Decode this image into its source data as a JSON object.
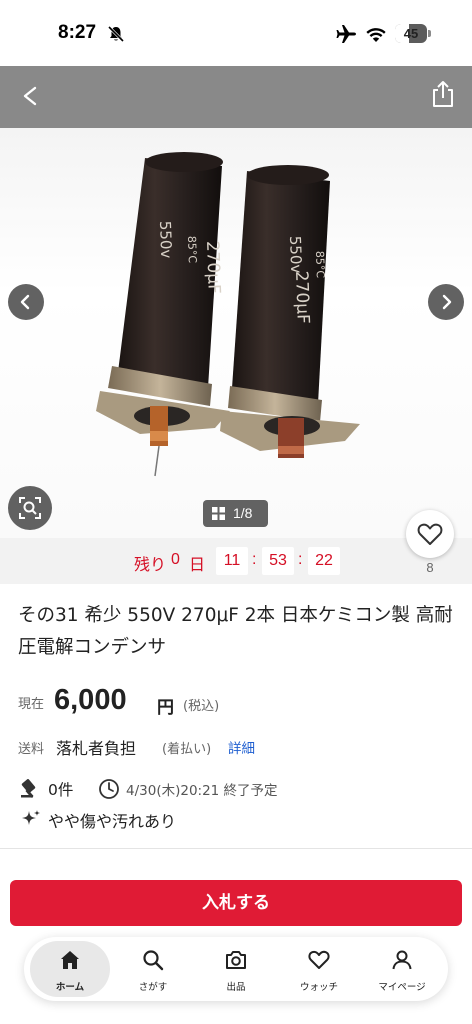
{
  "status_bar": {
    "time": "8:27",
    "battery": "45",
    "battery_fraction": 0.45
  },
  "photo": {
    "counter": "1/8",
    "icons": [
      "back-icon",
      "share-icon",
      "prev-image-icon",
      "next-image-icon",
      "image-search-icon",
      "grid-icon"
    ]
  },
  "timer": {
    "label_remaining": "残り",
    "days": "0",
    "label_day": "日",
    "hours": "11",
    "minutes": "53",
    "seconds": "22",
    "colon": ":"
  },
  "watch": {
    "count": "8",
    "icon": "heart-icon"
  },
  "item": {
    "title": "その31 希少 550V 270μF 2本 日本ケミコン製 高耐圧電解コンデンサ",
    "price_label": "現在",
    "price_value": "6,000",
    "price_unit": "円",
    "price_tax": "(税込)",
    "shipping_label": "送料",
    "shipping_value": "落札者負担",
    "shipping_note": "(着払い)",
    "shipping_link": "詳細",
    "bids": "0件",
    "end_time": "4/30(木)20:21 終了予定",
    "condition": "やや傷や汚れあり"
  },
  "actions": {
    "bid_button": "入札する"
  },
  "tabbar": {
    "items": [
      {
        "label": "ホーム",
        "icon": "home-icon"
      },
      {
        "label": "さがす",
        "icon": "search-icon"
      },
      {
        "label": "出品",
        "icon": "camera-icon"
      },
      {
        "label": "ウォッチ",
        "icon": "heart-icon"
      },
      {
        "label": "マイページ",
        "icon": "person-icon"
      }
    ]
  },
  "colors": {
    "accent": "#e01b35",
    "timer_red": "#d50f25",
    "link": "#1f5fd0"
  }
}
